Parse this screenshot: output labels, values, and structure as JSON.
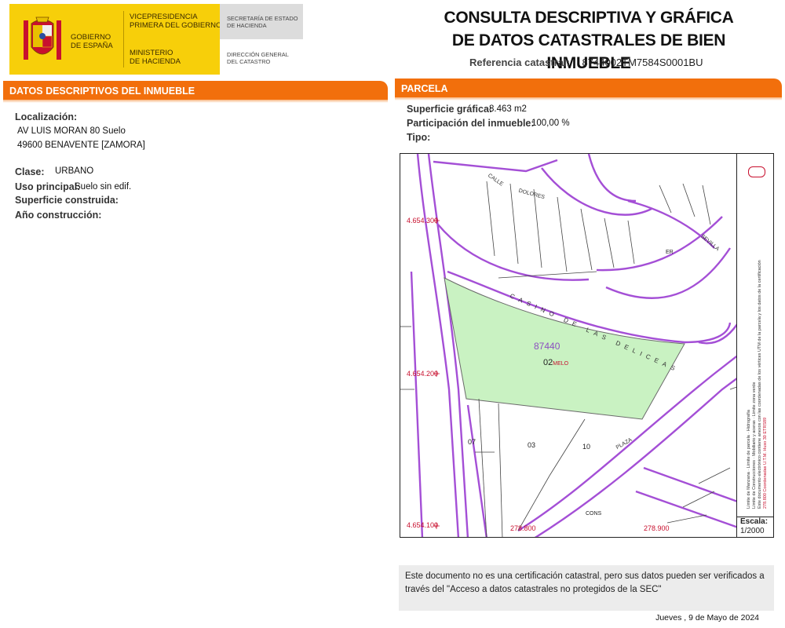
{
  "header": {
    "gov_line1": "GOBIERNO",
    "gov_line2": "DE ESPAÑA",
    "vice_line1": "VICEPRESIDENCIA",
    "vice_line2": "PRIMERA DEL GOBIERNO",
    "min_line1": "MINISTERIO",
    "min_line2": "DE HACIENDA",
    "sec_line1": "SECRETARÍA DE ESTADO",
    "sec_line2": "DE HACIENDA",
    "dir_line1": "DIRECCIÓN GENERAL",
    "dir_line2": "DEL CATASTRO",
    "title_line1": "CONSULTA DESCRIPTIVA Y GRÁFICA",
    "title_line2": "DE DATOS CATASTRALES DE BIEN INMUEBLE",
    "ref_label": "Referencia catastral:",
    "ref_value": "8744002TM7584S0001BU"
  },
  "left": {
    "bar": "DATOS DESCRIPTIVOS DEL INMUEBLE",
    "loc_label": "Localización:",
    "loc_line1": "AV LUIS MORAN 80 Suelo",
    "loc_line2": "49600 BENAVENTE [ZAMORA]",
    "clase_label": "Clase:",
    "clase_value": "URBANO",
    "uso_label": "Uso principal:",
    "uso_value": "Suelo sin edif.",
    "sup_label": "Superficie construida:",
    "anio_label": "Año construcción:"
  },
  "right": {
    "bar": "PARCELA",
    "supg_label": "Superficie gráfica:",
    "supg_value": "8.463 m2",
    "part_label": "Participación del inmueble:",
    "part_value": "100,00 %",
    "tipo_label": "Tipo:"
  },
  "map": {
    "parcel_id": "87440",
    "sub_id": "02",
    "sub_tag": "MELO",
    "coord_top": "4.654.300",
    "coord_mid": "4.654.200",
    "coord_bot": "4.654.100",
    "coord_x1": "278.800",
    "coord_x2": "278.900",
    "street_casino": "CASINO DE LAS DELICEAS",
    "street_calle": "CALLE",
    "street_plaza": "PLAZA",
    "street_sevilla": "SEVILLA",
    "street_dolores": "DOLORES",
    "lot_07": "07",
    "lot_03": "03",
    "lot_10": "10",
    "lot_er": "ER",
    "lot_cons": "CONS",
    "scale_label": "Escala:",
    "scale_value": "1/2000",
    "legend_1": "Límite de Manzana",
    "legend_2": "Límite de parcela",
    "legend_3": "Hidrografía",
    "legend_4": "Límite de Construcciones",
    "legend_5": "Mobiliario y aceras",
    "legend_6": "Límite zona verde",
    "legend_7": "Este documento electrónico contiene anexos con las coordenadas de los vértices UTM de la parcela y los datos de la certificación",
    "legend_8": "278.800 Coordenadas U.T.M. Huso 30 ETRS89"
  },
  "footer": {
    "note": "Este documento no es una certificación catastral, pero sus datos pueden ser verificados a través del \"Acceso a datos catastrales no protegidos de la SEC\"",
    "date": "Jueves , 9 de Mayo de 2024"
  },
  "colors": {
    "accent": "#f26f0c",
    "logo_yellow": "#f7cf0a",
    "parcel_green": "#c9f2c2",
    "street_purple": "#a44fd6"
  }
}
